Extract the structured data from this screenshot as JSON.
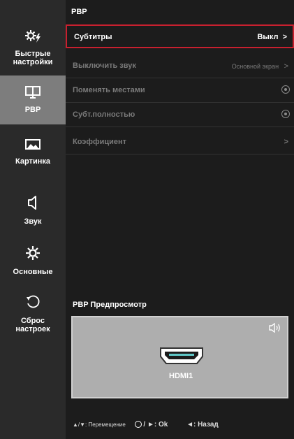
{
  "sidebar": {
    "items": [
      {
        "label_line1": "Быстрые",
        "label_line2": "настройки",
        "icon": "quick-settings-icon"
      },
      {
        "label_line1": "PBP",
        "label_line2": "",
        "icon": "pbp-monitor-icon",
        "active": true
      },
      {
        "label_line1": "Картинка",
        "label_line2": "",
        "icon": "picture-icon"
      },
      {
        "label_line1": "Звук",
        "label_line2": "",
        "icon": "speaker-icon"
      },
      {
        "label_line1": "Основные",
        "label_line2": "",
        "icon": "gear-icon"
      },
      {
        "label_line1": "Сброс",
        "label_line2": "настроек",
        "icon": "reset-icon"
      }
    ]
  },
  "main": {
    "title": "PBP",
    "rows": [
      {
        "label": "Субтитры",
        "value": "Выкл",
        "arrow": ">"
      },
      {
        "label": "Выключить звук",
        "value": "Основной экран",
        "arrow": ">"
      },
      {
        "label": "Поменять местами",
        "value": "",
        "arrow": ""
      },
      {
        "label": "Субт.полностью",
        "value": "",
        "arrow": ""
      },
      {
        "label": "Коэффициент",
        "value": "",
        "arrow": ">"
      }
    ],
    "preview": {
      "title": "PBP Предпросмотр",
      "source": "HDMI1"
    }
  },
  "footer": {
    "move": "▲/▼: Перемещение",
    "ok": "/ ►: Ok",
    "back": "◄: Назад"
  },
  "colors": {
    "selection_border": "#c8202f",
    "active_sidebar": "#7d7d7d",
    "background": "#1c1c1c"
  }
}
